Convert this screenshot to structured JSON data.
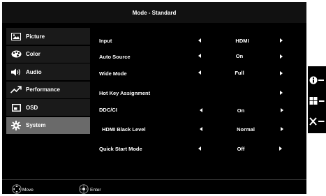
{
  "title": "Mode - Standard",
  "sidebar": {
    "items": [
      {
        "label": "Picture",
        "icon": "picture-icon"
      },
      {
        "label": "Color",
        "icon": "palette-icon"
      },
      {
        "label": "Audio",
        "icon": "speaker-icon"
      },
      {
        "label": "Performance",
        "icon": "trend-icon"
      },
      {
        "label": "OSD",
        "icon": "osd-window-icon"
      },
      {
        "label": "System",
        "icon": "gear-icon",
        "selected": true
      }
    ]
  },
  "settings": [
    {
      "label": "Input",
      "value": "HDMI"
    },
    {
      "label": "Auto Source",
      "value": "On"
    },
    {
      "label": "Wide Mode",
      "value": "Full"
    },
    {
      "label": "Hot Key Assignment",
      "value": ""
    },
    {
      "label": "DDC/CI",
      "value": "On"
    },
    {
      "label": "HDMI Black Level",
      "value": "Normal"
    },
    {
      "label": "Quick Start Mode",
      "value": "Off"
    }
  ],
  "footer": {
    "move_label": "Move",
    "enter_label": "Enter"
  },
  "keys": [
    "info-icon",
    "menu-grid-icon",
    "close-icon"
  ]
}
